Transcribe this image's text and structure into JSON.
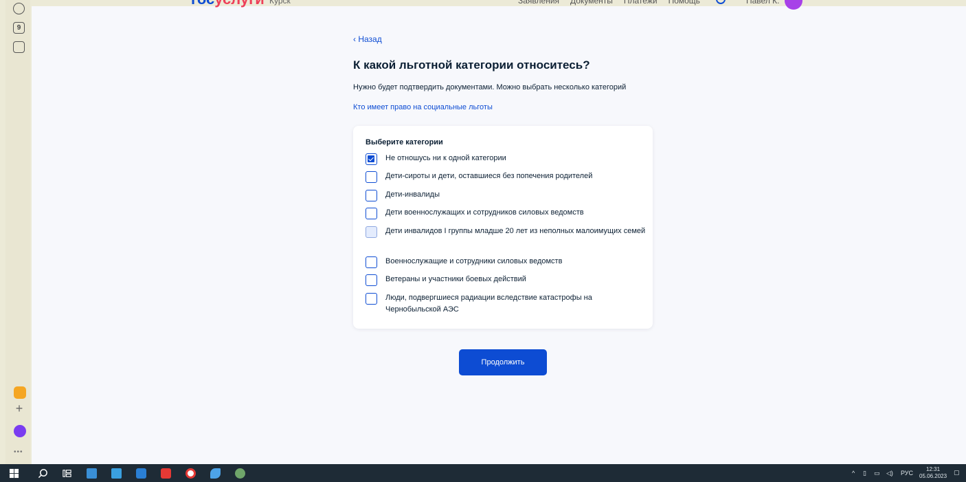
{
  "header": {
    "logo_blue": "гос",
    "logo_red": "услуги",
    "region": "Курск",
    "nav": [
      "Заявления",
      "Документы",
      "Платежи",
      "Помощь"
    ],
    "user": "Павел К."
  },
  "back_label": "Назад",
  "page_title": "К какой льготной категории относитесь?",
  "subtitle": "Нужно будет подтвердить документами. Можно выбрать несколько категорий",
  "info_link": "Кто имеет право на социальные льготы",
  "form": {
    "title": "Выберите категории",
    "options": [
      {
        "label": "Не отношусь ни к одной категории",
        "checked": true
      },
      {
        "label": "Дети-сироты и дети, оставшиеся без попечения родителей",
        "checked": false
      },
      {
        "label": "Дети-инвалиды",
        "checked": false
      },
      {
        "label": "Дети военнослужащих и сотрудников силовых ведомств",
        "checked": false
      },
      {
        "label": "Дети инвалидов I группы младше 20 лет из неполных малоимущих семей",
        "checked": false
      },
      {
        "label": "Военнослужащие и сотрудники силовых ведомств",
        "checked": false
      },
      {
        "label": "Ветераны и участники боевых действий",
        "checked": false
      },
      {
        "label": "Люди, подвергшиеся радиации вследствие катастрофы на Чернобыльской АЭС",
        "checked": false
      }
    ]
  },
  "continue_label": "Продолжить",
  "sidebar": {
    "badge_label": "9"
  },
  "taskbar": {
    "language": "РУС",
    "time": "12:31",
    "date": "05.06.2023"
  },
  "colors": {
    "primary": "#0d4cd3",
    "text": "#0b1f33",
    "background": "#f7f8fc",
    "taskbar": "#1e2b36"
  }
}
